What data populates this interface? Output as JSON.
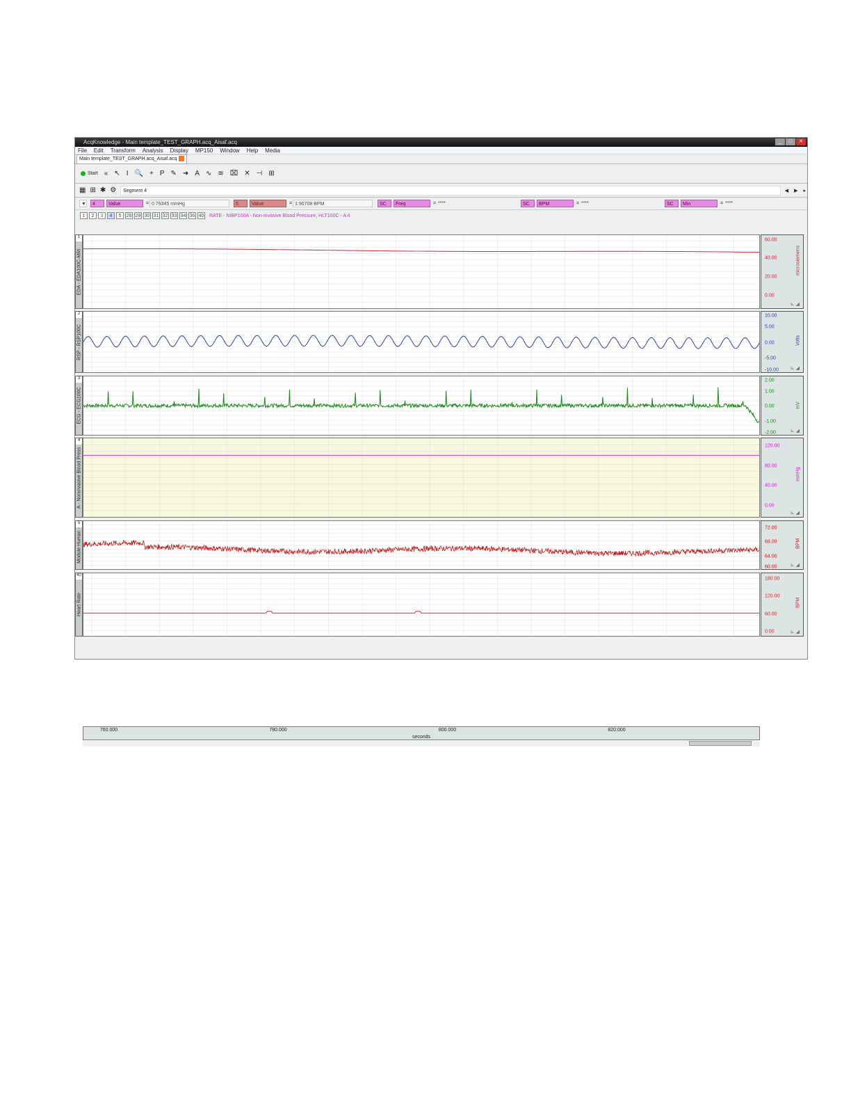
{
  "window": {
    "title": "AcqKnowledge - Main template_TEST_GRAPH.acq_Aisaf.acq",
    "controls": [
      "_",
      "□",
      "✕"
    ]
  },
  "menu": [
    "File",
    "Edit",
    "Transform",
    "Analysis",
    "Display",
    "MP150",
    "Window",
    "Help",
    "Media"
  ],
  "tab": {
    "label": "Main template_TEST_GRAPH.acq_Aisaf.acq"
  },
  "toolbar": {
    "start_label": "Start",
    "tools": [
      "«",
      "↖",
      "I",
      "🔍",
      "+",
      "P",
      "✎",
      "➜",
      "A",
      "∿",
      "≋",
      "⌧",
      "✕",
      "⊣",
      "⊞"
    ]
  },
  "segment": {
    "label": "Segment 4",
    "icons": [
      "▦",
      "⊞",
      "✱",
      "⚙"
    ],
    "nav": [
      "◀",
      "▶",
      "▸"
    ]
  },
  "measurements": [
    {
      "channel": "4",
      "type": "Value",
      "result": "0.79345 mmHg",
      "style": "pk"
    },
    {
      "channel": "5",
      "type": "Value",
      "result": "1.90708 BPM",
      "style": "rd"
    },
    {
      "channel": "SC",
      "type": "Freq",
      "result": "****",
      "style": "pk"
    },
    {
      "channel": "SC",
      "type": "BPM",
      "result": "****",
      "style": "pk"
    },
    {
      "channel": "SC",
      "type": "Min",
      "result": "****",
      "style": "pk"
    }
  ],
  "channel_buttons": [
    "1",
    "2",
    "3",
    "4",
    "5",
    "28",
    "29",
    "30",
    "31",
    "32",
    "33",
    "34",
    "36",
    "40"
  ],
  "active_channel_desc": "RATE - NIBP100A - Non-invasive Blood Pressure, HLT100C - A 4",
  "chart_data": {
    "type": "line",
    "xlabel": "seconds",
    "xlim": [
      757,
      837
    ],
    "xticks": [
      "760.000",
      "780.000",
      "800.000",
      "820.000"
    ],
    "xtick_values": [
      760,
      780,
      800,
      820
    ],
    "channels": [
      {
        "num": "1",
        "name": "EDA - EDA100C-MRI",
        "unit": "microsiemens",
        "color": "#c8283c",
        "ticks": [
          "60.00",
          "40.00",
          "20.00",
          "0.00"
        ],
        "tick_values": [
          60,
          40,
          20,
          0
        ],
        "ylim": [
          -15,
          65
        ],
        "level_start": 50,
        "level_end": 46,
        "kind": "drift"
      },
      {
        "num": "2",
        "name": "RSP - RSP100C",
        "unit": "Volts",
        "color": "#2c3ea8",
        "ticks": [
          "10.00",
          "5.00",
          "0.00",
          "-5.00",
          "-10.00"
        ],
        "tick_values": [
          10,
          5,
          0,
          -5,
          -10
        ],
        "ylim": [
          -10,
          10
        ],
        "level_start": 0,
        "level_end": 0,
        "kind": "resp"
      },
      {
        "num": "3",
        "name": "ECG - ECG100C",
        "unit": "mV",
        "color": "#1a8a1a",
        "ticks": [
          "2.00",
          "1.00",
          "0.00",
          "-1.00",
          "-2.00"
        ],
        "tick_values": [
          2,
          1,
          0,
          -1,
          -2
        ],
        "ylim": [
          -2,
          2
        ],
        "level_start": 0,
        "level_end": 0,
        "kind": "ecg"
      },
      {
        "num": "4",
        "name": "A - Noninvasive Blood Press",
        "unit": "mmHg",
        "color": "#d020d0",
        "ticks": [
          "120.00",
          "80.00",
          "40.00",
          "0.00"
        ],
        "tick_values": [
          120,
          80,
          40,
          0
        ],
        "ylim": [
          -25,
          135
        ],
        "level_start": 100,
        "level_end": 100,
        "kind": "flat",
        "bg": "#f8f8dc"
      },
      {
        "num": "5",
        "name": "Module Human -",
        "unit": "BPM",
        "color": "#c01818",
        "ticks": [
          "72.00",
          "68.00",
          "64.00",
          "60.00"
        ],
        "tick_values": [
          72,
          68,
          64,
          60
        ],
        "ylim": [
          60,
          74
        ],
        "level_start": 66,
        "level_end": 65,
        "kind": "noise"
      },
      {
        "num": "40",
        "name": "Heart Rate",
        "unit": "BPM",
        "color": "#c03030",
        "ticks": [
          "180.00",
          "120.00",
          "60.00",
          "0.00"
        ],
        "tick_values": [
          180,
          120,
          60,
          0
        ],
        "ylim": [
          -20,
          200
        ],
        "level_start": 60,
        "level_end": 60,
        "kind": "hr"
      }
    ]
  }
}
